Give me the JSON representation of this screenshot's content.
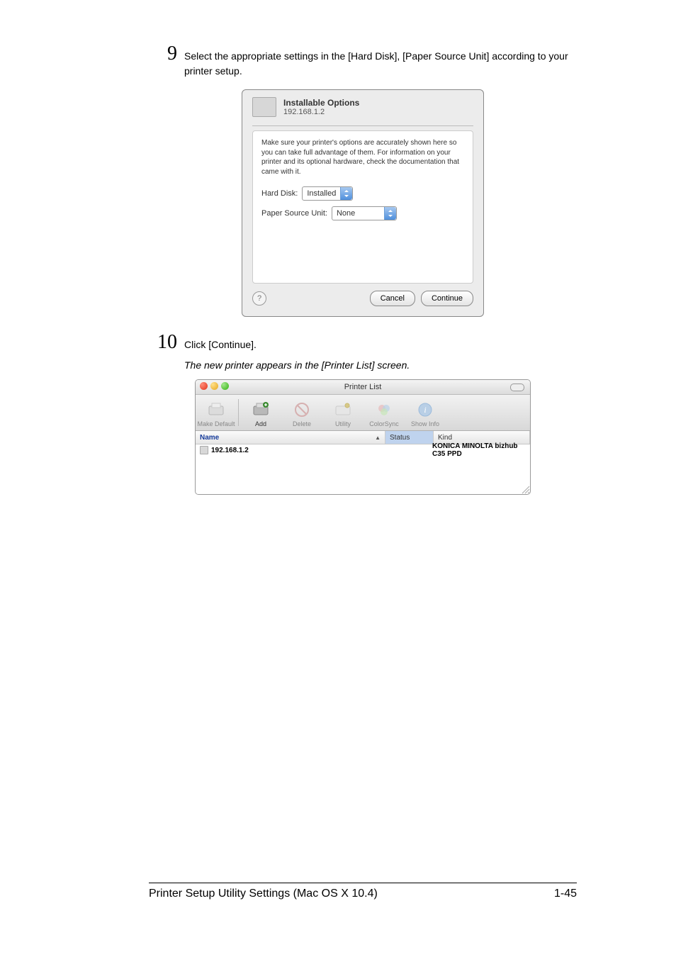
{
  "step9": {
    "num": "9",
    "text": "Select the appropriate settings in the [Hard Disk], [Paper Source Unit] according to your printer setup."
  },
  "dialog": {
    "title": "Installable Options",
    "ip": "192.168.1.2",
    "description": "Make sure your printer's options are accurately shown here so you can take full advantage of them.  For information on your printer and its optional hardware, check the documentation that came with it.",
    "hd_label": "Hard Disk:",
    "hd_value": "Installed",
    "psu_label": "Paper Source Unit:",
    "psu_value": "None",
    "help": "?",
    "cancel": "Cancel",
    "continue": "Continue"
  },
  "step10": {
    "num": "10",
    "text": "Click [Continue].",
    "result": "The new printer appears in the [Printer List] screen."
  },
  "printerlist": {
    "title": "Printer List",
    "toolbar": {
      "makedefault": "Make Default",
      "add": "Add",
      "delete": "Delete",
      "utility": "Utility",
      "colorsync": "ColorSync",
      "showinfo": "Show Info"
    },
    "cols": {
      "name": "Name",
      "status": "Status",
      "kind": "Kind"
    },
    "row": {
      "name": "192.168.1.2",
      "kind": "KONICA MINOLTA bizhub C35 PPD"
    }
  },
  "footer": {
    "left": "Printer Setup Utility Settings (Mac OS X 10.4)",
    "right": "1-45"
  }
}
